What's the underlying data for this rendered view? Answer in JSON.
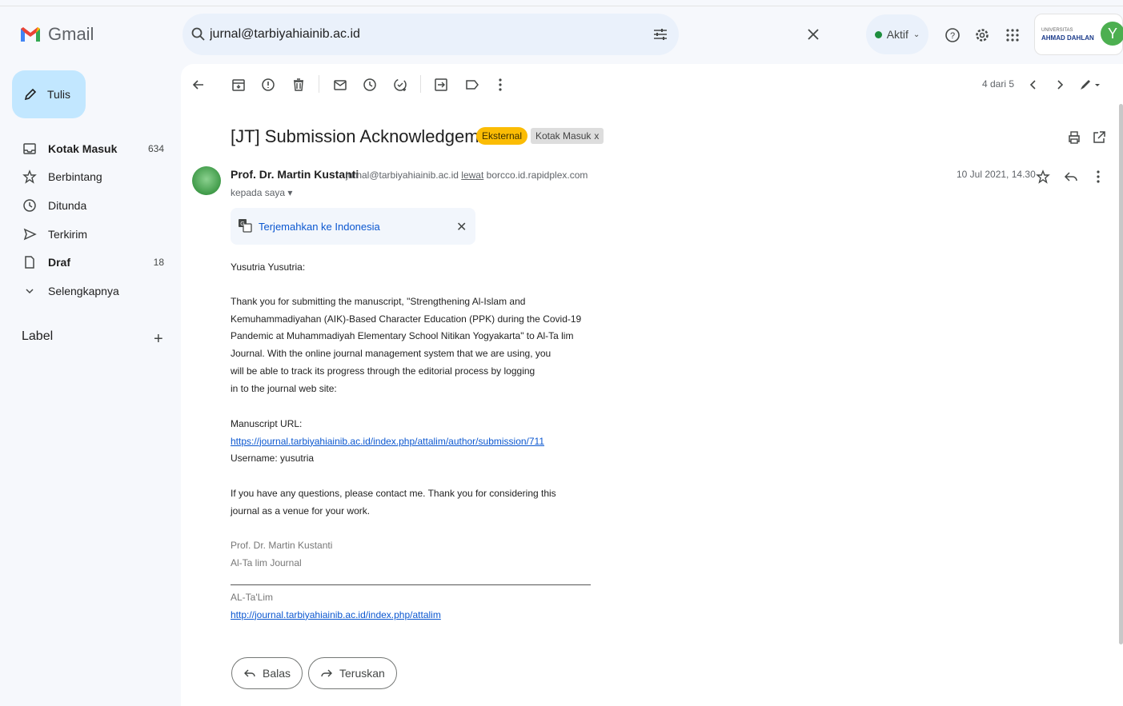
{
  "app": {
    "name": "Gmail"
  },
  "search": {
    "value": "jurnal@tarbiyahiainib.ac.id"
  },
  "status": {
    "label": "Aktif"
  },
  "account": {
    "org_small": "UNIVERSITAS",
    "org_name": "AHMAD DAHLAN",
    "initial": "Y"
  },
  "compose": {
    "label": "Tulis"
  },
  "sidebar": {
    "items": [
      {
        "label": "Kotak Masuk",
        "count": "634"
      },
      {
        "label": "Berbintang",
        "count": ""
      },
      {
        "label": "Ditunda",
        "count": ""
      },
      {
        "label": "Terkirim",
        "count": ""
      },
      {
        "label": "Draf",
        "count": "18"
      },
      {
        "label": "Selengkapnya",
        "count": ""
      }
    ],
    "label_header": "Label"
  },
  "toolbar": {
    "pager": "4 dari 5"
  },
  "email": {
    "subject": "[JT] Submission Acknowledgement",
    "badge_external": "Eksternal",
    "badge_inbox": "Kotak Masuk",
    "sender_name": "Prof. Dr. Martin Kustanti",
    "sender_email": "jurnal@tarbiyahiainib.ac.id",
    "via_label": "lewat",
    "via_domain": "borcco.id.rapidplex.com",
    "to": "kepada saya",
    "date": "10 Jul 2021, 14.30",
    "translate_label": "Terjemahkan ke Indonesia",
    "greeting": "Yusutria Yusutria:",
    "para1": [
      "Thank you for submitting the manuscript, \"Strengthening Al-Islam and",
      "Kemuhammadiyahan (AIK)-Based Character Education (PPK) during the Covid-19",
      "Pandemic at Muhammadiyah Elementary School Nitikan Yogyakarta\" to Al-Ta lim",
      "Journal. With the online journal management system that we are using, you",
      "will be able to track its progress through the editorial process by logging",
      "in to the journal web site:"
    ],
    "manuscript_url_label": "Manuscript URL:",
    "manuscript_url": "https://journal.tarbiyahiainib.ac.id/index.php/attalim/author/submission/711",
    "username_line": "Username: yusutria",
    "para2": [
      "If you have any questions, please contact me. Thank you for considering this",
      "journal as a venue for your work."
    ],
    "signature_name": "Prof. Dr. Martin Kustanti",
    "signature_journal": "Al-Ta lim Journal",
    "footer_title": "AL-Ta'Lim",
    "footer_url": "http://journal.tarbiyahiainib.ac.id/index.php/attalim"
  },
  "actions": {
    "reply": "Balas",
    "forward": "Teruskan"
  }
}
